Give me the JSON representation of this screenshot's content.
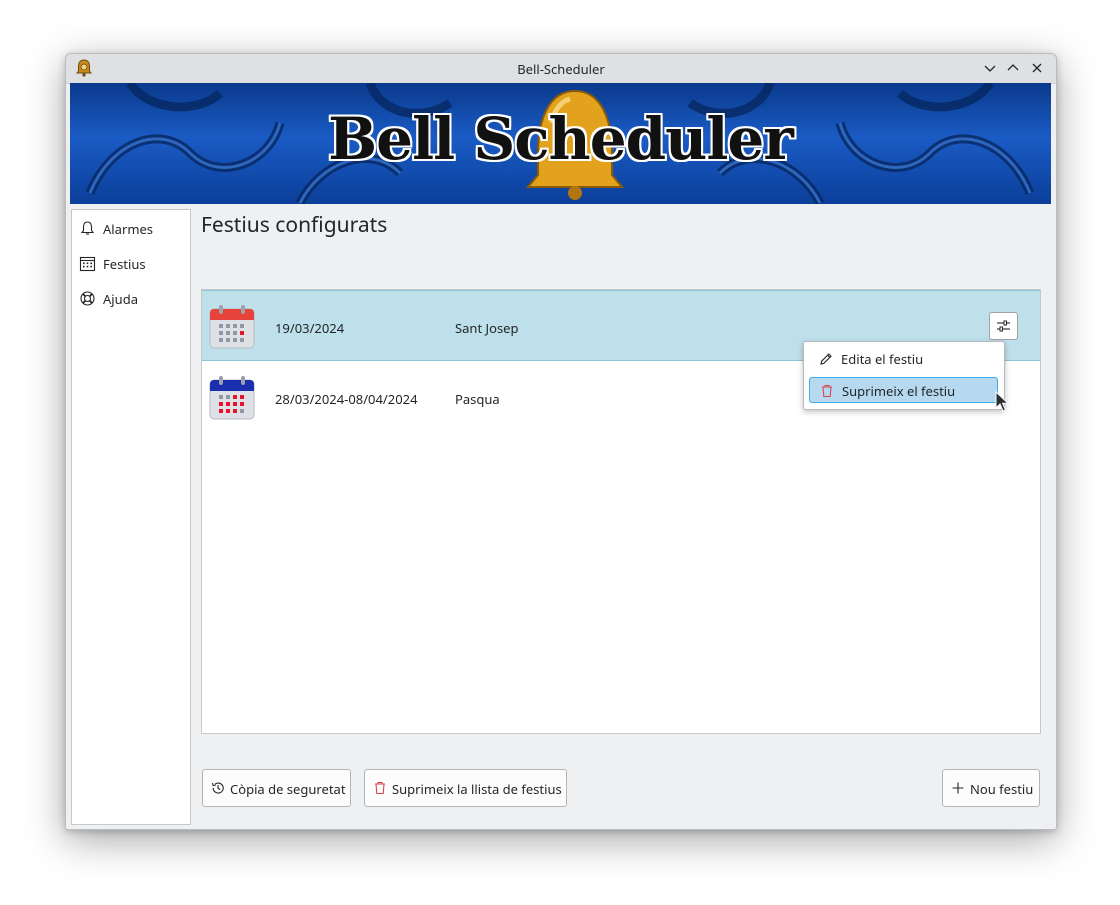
{
  "window": {
    "title": "Bell-Scheduler",
    "controls": [
      "minimize-icon",
      "maximize-icon",
      "close-icon"
    ]
  },
  "banner": {
    "title": "Bell Scheduler"
  },
  "sidebar": {
    "items": [
      {
        "label": "Alarmes",
        "icon": "bell-icon"
      },
      {
        "label": "Festius",
        "icon": "calendar-icon"
      },
      {
        "label": "Ajuda",
        "icon": "lifebuoy-icon"
      }
    ]
  },
  "main": {
    "title": "Festius configurats",
    "holidays": [
      {
        "date": "19/03/2024",
        "name": "Sant Josep",
        "icon": "calendar-single-day-icon",
        "selected": true
      },
      {
        "date": "28/03/2024-08/04/2024",
        "name": "Pasqua",
        "icon": "calendar-range-icon",
        "selected": false
      }
    ],
    "context_menu": {
      "items": [
        {
          "label": "Edita el festiu",
          "icon": "pencil-icon"
        },
        {
          "label": "Suprimeix el festiu",
          "icon": "trash-icon",
          "highlighted": true
        }
      ]
    }
  },
  "footer": {
    "backup_label": "Còpia de seguretat",
    "delete_all_label": "Suprimeix la llista de festius",
    "new_label": "Nou festiu"
  },
  "colors": {
    "selection": "#bde0ea",
    "highlight_border": "#3daee9",
    "danger_icon": "#da4453",
    "calendar_red": "#e8433a",
    "calendar_blue": "#1a2eb0"
  }
}
